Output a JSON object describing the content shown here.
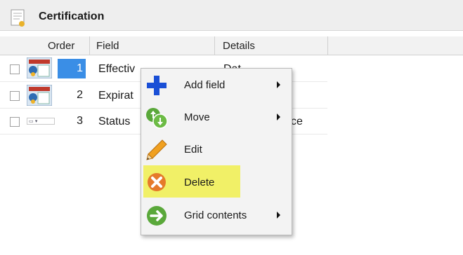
{
  "panel": {
    "title": "Certification",
    "title_icon": "certificate-document-icon"
  },
  "grid": {
    "columns": [
      "Order",
      "Field",
      "Details"
    ],
    "rows": [
      {
        "order": "1",
        "field": "Effectiv",
        "details": "Dat",
        "selected": true
      },
      {
        "order": "2",
        "field": "Expirat",
        "details": "",
        "selected": false
      },
      {
        "order": "3",
        "field": "Status",
        "details": "ce",
        "selected": false
      }
    ]
  },
  "context_menu": {
    "items": [
      {
        "label": "Add field",
        "icon": "plus-icon",
        "submenu": true
      },
      {
        "label": "Move",
        "icon": "move-arrows-icon",
        "submenu": true
      },
      {
        "label": "Edit",
        "icon": "pencil-icon",
        "submenu": false
      },
      {
        "label": "Delete",
        "icon": "delete-x-icon",
        "submenu": false,
        "highlighted": true
      },
      {
        "label": "Grid contents",
        "icon": "arrow-right-circle-icon",
        "submenu": true
      }
    ],
    "highlight_color": "#f1f067"
  },
  "colors": {
    "selection": "#3a8ee6",
    "plus": "#1a4fd6",
    "green": "#5aa83a",
    "delete": "#e57a2a"
  }
}
